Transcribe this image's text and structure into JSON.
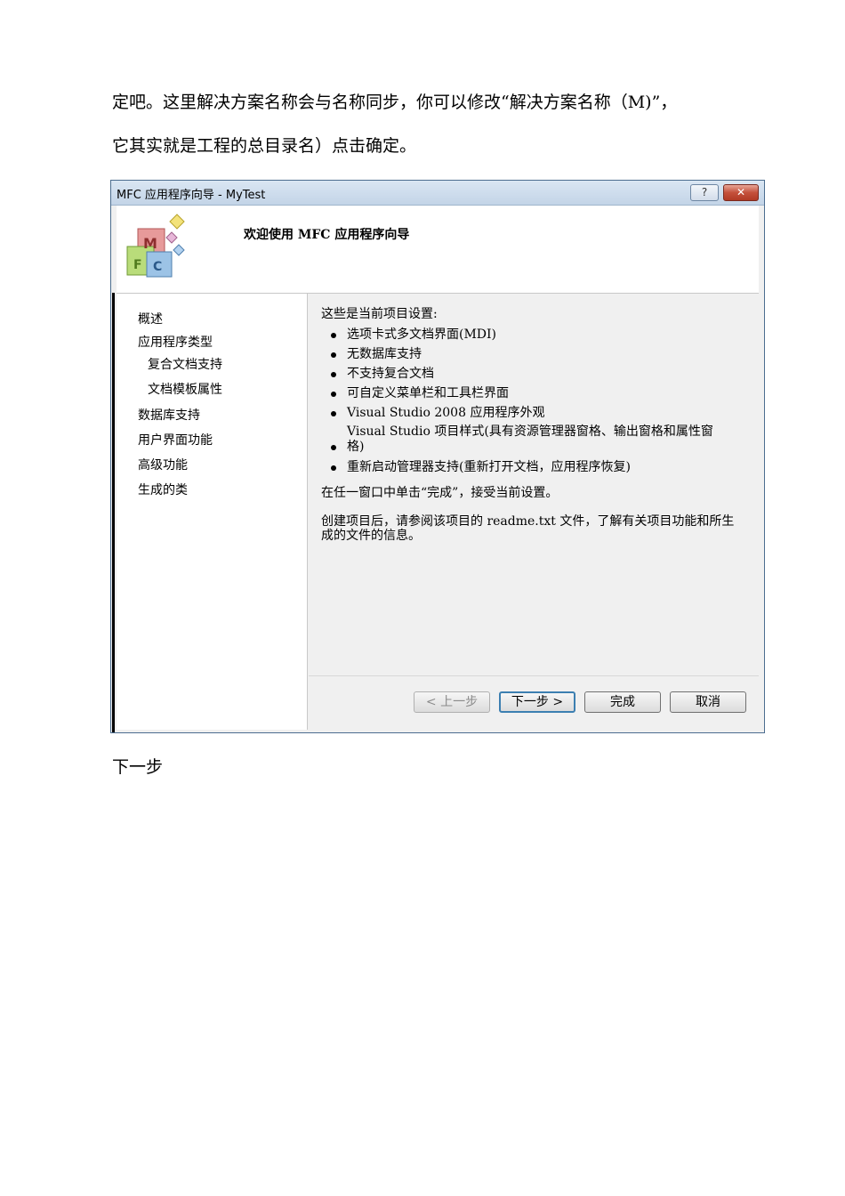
{
  "document": {
    "line1": "定吧。这里解决方案名称会与名称同步，你可以修改“解决方案名称（M)”，",
    "line2": "它其实就是工程的总目录名）点击确定。",
    "line3": "下一步"
  },
  "dialog": {
    "title": "MFC 应用程序向导 - MyTest",
    "help_glyph": "?",
    "close_glyph": "✕",
    "banner_title": "欢迎使用 MFC 应用程序向导",
    "logo_letters": [
      "M",
      "F",
      "C"
    ],
    "nav": [
      "概述",
      "应用程序类型",
      "复合文档支持",
      "文档模板属性",
      "数据库支持",
      "用户界面功能",
      "高级功能",
      "生成的类"
    ],
    "content": {
      "heading": "这些是当前项目设置:",
      "bullets": [
        "选项卡式多文档界面(MDI)",
        "无数据库支持",
        "不支持复合文档",
        "可自定义菜单栏和工具栏界面",
        "Visual Studio 2008 应用程序外观",
        "Visual Studio 项目样式(具有资源管理器窗格、输出窗格和属性窗",
        "格)",
        "重新启动管理器支持(重新打开文档，应用程序恢复)"
      ],
      "note1": "在任一窗口中单击“完成”，接受当前设置。",
      "note2_line1": "创建项目后，请参阅该项目的 readme.txt 文件，了解有关项目功能和所生",
      "note2_line2": "成的文件的信息。"
    },
    "buttons": {
      "back": "< 上一步",
      "next": "下一步 >",
      "finish": "完成",
      "cancel": "取消"
    },
    "colors": {
      "titlebar": "#c3d4e7",
      "close_button": "#c4503b",
      "default_button_border": "#3c7fb1"
    }
  }
}
